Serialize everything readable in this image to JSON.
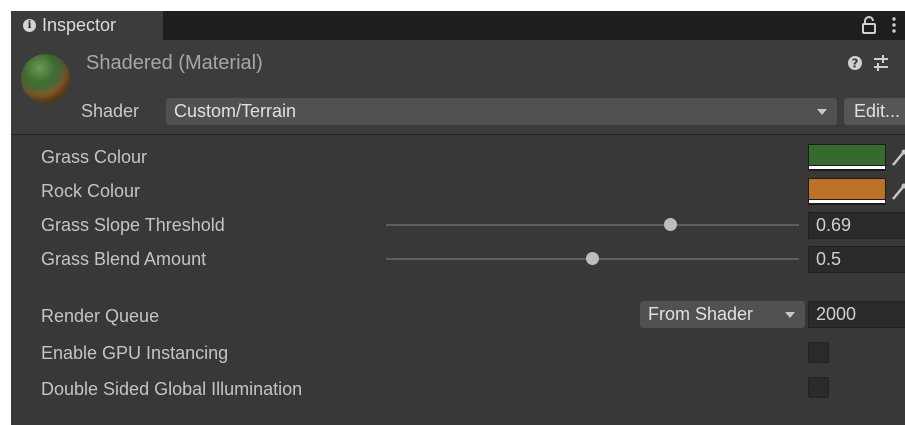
{
  "tab": {
    "title": "Inspector",
    "info_icon": "info-icon",
    "lock_icon": "lock-icon",
    "menu_icon": "kebab-menu-icon"
  },
  "material": {
    "title": "Shadered (Material)",
    "shader_label": "Shader",
    "shader_value": "Custom/Terrain",
    "edit_label": "Edit...",
    "help_icon": "help-icon",
    "settings_icon": "preset-settings-icon"
  },
  "properties": {
    "grass_colour": {
      "label": "Grass Colour",
      "color": "#366b30"
    },
    "rock_colour": {
      "label": "Rock Colour",
      "color": "#bd7124"
    },
    "grass_slope": {
      "label": "Grass Slope Threshold",
      "value": "0.69",
      "fraction": 0.69
    },
    "grass_blend": {
      "label": "Grass Blend Amount",
      "value": "0.5",
      "fraction": 0.5
    },
    "render_queue": {
      "label": "Render Queue",
      "mode": "From Shader",
      "value": "2000"
    },
    "gpu_instancing": {
      "label": "Enable GPU Instancing",
      "checked": false
    },
    "double_sided_gi": {
      "label": "Double Sided Global Illumination",
      "checked": false
    }
  },
  "colors": {
    "panel_bg": "#383838",
    "header_bg": "#3c3c3c",
    "tab_strip": "#1e1e1e",
    "field_bg": "#2a2a2a"
  }
}
